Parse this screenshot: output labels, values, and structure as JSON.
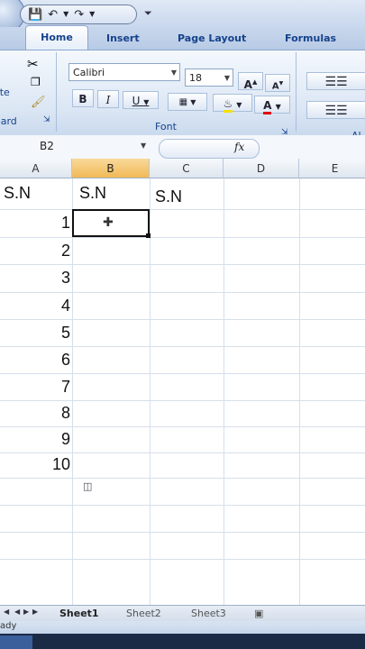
{
  "ribbon": {
    "tabs": [
      "Home",
      "Insert",
      "Page Layout",
      "Formulas"
    ],
    "clipboard_paste_label": "ste",
    "clipboard_group_label": "oard",
    "font_group_label": "Font",
    "alignment_group_label": "Al",
    "font_name": "Calibri",
    "font_size": "18",
    "bold": "B",
    "italic": "I",
    "underline": "U",
    "grow_font": "A",
    "shrink_font": "A",
    "font_color": "A"
  },
  "formula_bar": {
    "name_box": "B2",
    "fx_label": "fx",
    "formula": ""
  },
  "grid": {
    "columns": [
      "A",
      "B",
      "C",
      "D",
      "E"
    ],
    "selected_column": "B",
    "header_row": [
      "S.N",
      "S.N",
      "S.N"
    ],
    "row_numbers": [
      "1",
      "2",
      "3",
      "4",
      "5",
      "6",
      "7",
      "8",
      "9",
      "10"
    ]
  },
  "sheets": [
    "Sheet1",
    "Sheet2",
    "Sheet3"
  ],
  "status": {
    "text": "ady"
  },
  "colors": {
    "selected_header": "#f1b955",
    "ribbon_text": "#15428b"
  }
}
